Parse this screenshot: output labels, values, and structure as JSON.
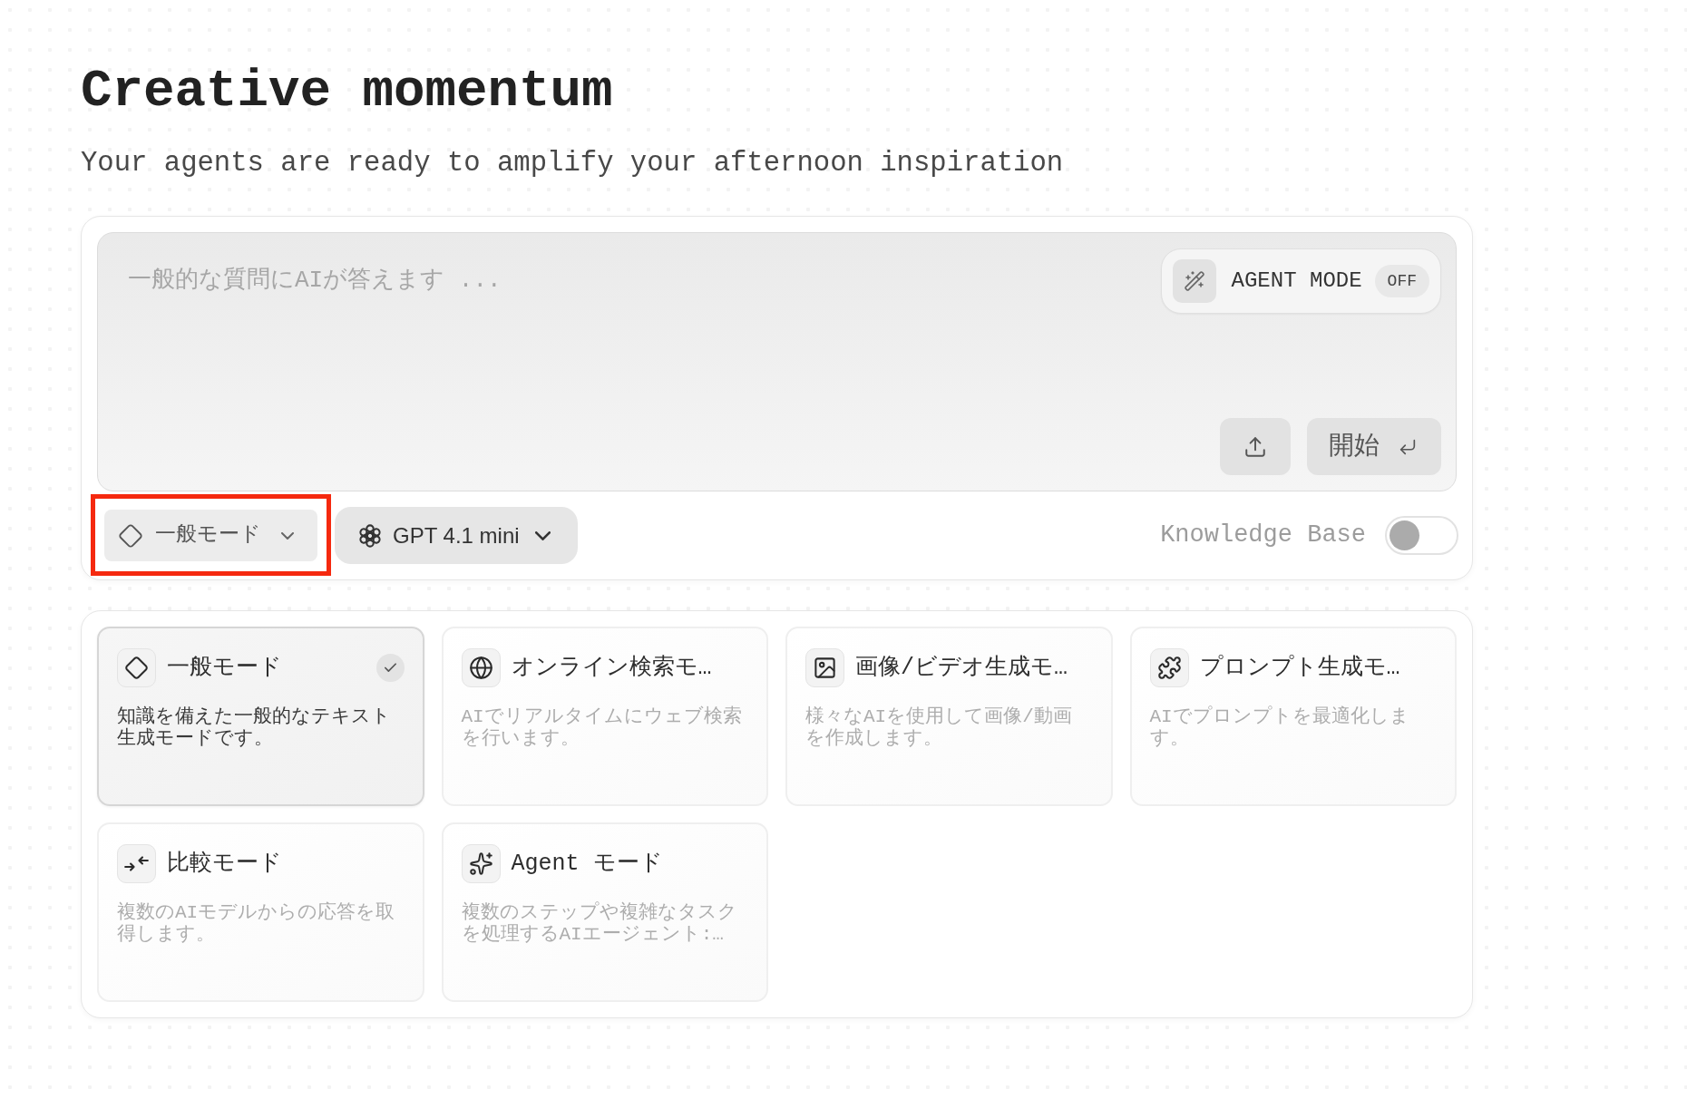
{
  "header": {
    "title": "Creative momentum",
    "subtitle": "Your agents are ready to amplify your afternoon inspiration"
  },
  "composer": {
    "prompt": {
      "placeholder": "一般的な質問にAIが答えます ..."
    },
    "agent_mode": {
      "label": "AGENT MODE",
      "status": "OFF",
      "on": false
    },
    "start_button": {
      "label": "開始"
    }
  },
  "toolbar": {
    "mode_dropdown": {
      "kind": "general",
      "label": "一般モード",
      "highlighted": true
    },
    "model_dropdown": {
      "label": "GPT 4.1 mini"
    },
    "knowledge_base": {
      "label": "Knowledge Base",
      "on": false
    }
  },
  "modes": [
    {
      "kind": "general",
      "title": "一般モード",
      "description": "知識を備えた一般的なテキスト生成モードです。",
      "selected": true
    },
    {
      "kind": "search",
      "title": "オンライン検索モ…",
      "description": "AIでリアルタイムにウェブ検索を行います。",
      "selected": false
    },
    {
      "kind": "image",
      "title": "画像/ビデオ生成モ…",
      "description": "様々なAIを使用して画像/動画を作成します。",
      "selected": false
    },
    {
      "kind": "prompt",
      "title": "プロンプト生成モ…",
      "description": "AIでプロンプトを最適化します。",
      "selected": false
    },
    {
      "kind": "compare",
      "title": "比較モード",
      "description": "複数のAIモデルからの応答を取得します。",
      "selected": false
    },
    {
      "kind": "agent",
      "title": "Agent モード",
      "description": "複数のステップや複雑なタスクを処理するAIエージェント:…",
      "selected": false
    }
  ]
}
